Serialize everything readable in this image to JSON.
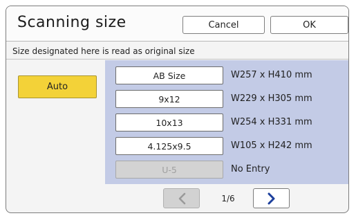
{
  "header": {
    "title": "Scanning size",
    "cancel_label": "Cancel",
    "ok_label": "OK"
  },
  "subtitle": "Size designated here is read as original size",
  "auto_label": "Auto",
  "sizes": [
    {
      "label": "AB Size",
      "desc": "W257 x H410 mm"
    },
    {
      "label": "9x12",
      "desc": "W229 x H305 mm"
    },
    {
      "label": "10x13",
      "desc": "W254 x H331 mm"
    },
    {
      "label": "4.125x9.5",
      "desc": "W105 x H242 mm"
    },
    {
      "label": "U-5",
      "desc": "No Entry",
      "disabled": true
    }
  ],
  "pager": {
    "page_indicator": "1/6",
    "prev_icon": "chevron-left-icon",
    "next_icon": "chevron-right-icon"
  },
  "colors": {
    "auto_button": "#f3d238",
    "panel_bg": "#c3cbe6",
    "next_arrow": "#1c3f9c"
  }
}
